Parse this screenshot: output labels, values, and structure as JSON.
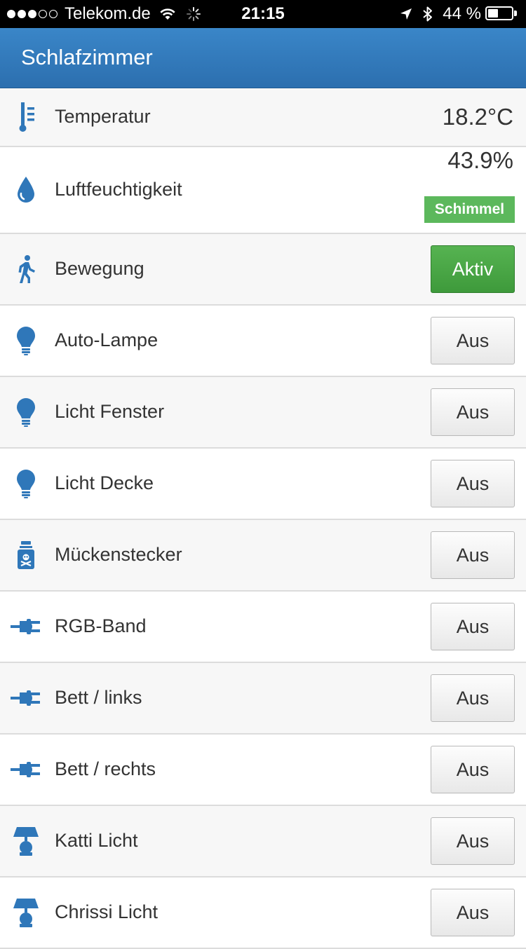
{
  "status_bar": {
    "signal_dots_filled": 3,
    "signal_dots_total": 5,
    "carrier": "Telekom.de",
    "time": "21:15",
    "battery_text": "44 %",
    "battery_level": 0.44,
    "icons": [
      "wifi-icon",
      "activity-spinner-icon",
      "location-arrow-icon",
      "bluetooth-icon",
      "battery-icon"
    ]
  },
  "header": {
    "title": "Schlafzimmer"
  },
  "rows": [
    {
      "label": "Temperatur",
      "icon": "thermometer-icon",
      "value": "18.2°C"
    },
    {
      "label": "Luftfeuchtigkeit",
      "icon": "water-drop-icon",
      "value": "43.9%",
      "badge": "Schimmel"
    },
    {
      "label": "Bewegung",
      "icon": "walking-person-icon",
      "button": "Aktiv",
      "state": "active"
    },
    {
      "label": "Auto-Lampe",
      "icon": "lightbulb-icon",
      "button": "Aus"
    },
    {
      "label": "Licht Fenster",
      "icon": "lightbulb-icon",
      "button": "Aus"
    },
    {
      "label": "Licht Decke",
      "icon": "lightbulb-icon",
      "button": "Aus"
    },
    {
      "label": "Mückenstecker",
      "icon": "poison-bottle-icon",
      "button": "Aus"
    },
    {
      "label": "RGB-Band",
      "icon": "plug-icon",
      "button": "Aus"
    },
    {
      "label": "Bett / links",
      "icon": "plug-icon",
      "button": "Aus"
    },
    {
      "label": "Bett / rechts",
      "icon": "plug-icon",
      "button": "Aus"
    },
    {
      "label": "Katti Licht",
      "icon": "table-lamp-icon",
      "button": "Aus"
    },
    {
      "label": "Chrissi Licht",
      "icon": "table-lamp-icon",
      "button": "Aus"
    }
  ],
  "colors": {
    "header_bg": "#2f77b9",
    "icon_blue": "#2f77b9",
    "active_green": "#4cae4c",
    "badge_green": "#5cb85c"
  }
}
